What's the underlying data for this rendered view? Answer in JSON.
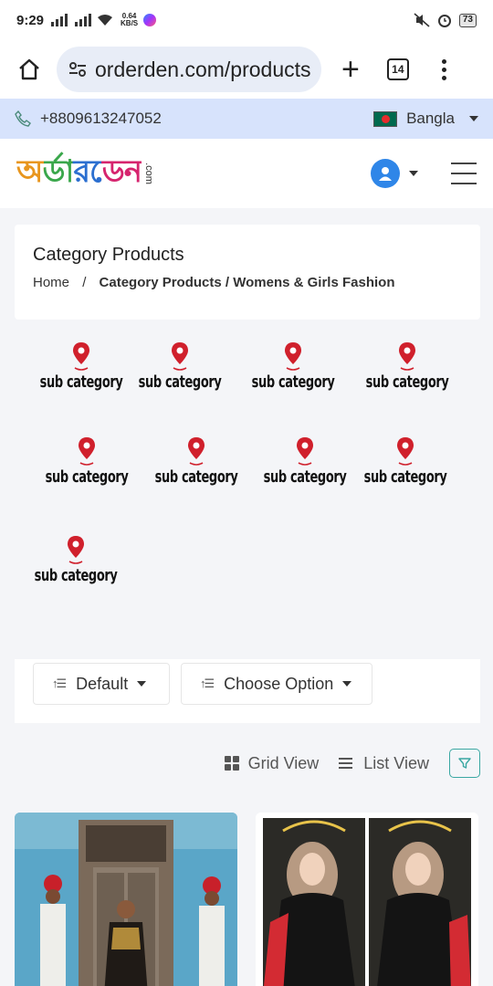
{
  "status_bar": {
    "time": "9:29",
    "net_speed_value": "0.64",
    "net_speed_unit": "KB/S",
    "battery": "73"
  },
  "browser": {
    "url": "orderden.com/products",
    "tab_count": "14"
  },
  "topbar": {
    "phone": "+8809613247052",
    "language": "Bangla"
  },
  "header": {
    "logo_text": "অর্ডারডেন",
    "logo_suffix": ".com"
  },
  "page": {
    "title": "Category Products",
    "breadcrumb": {
      "home": "Home",
      "separator": "/",
      "current": "Category Products / Womens & Girls Fashion"
    }
  },
  "sub_categories": [
    {
      "label": "sub category"
    },
    {
      "label": "sub category"
    },
    {
      "label": "sub category"
    },
    {
      "label": "sub category"
    },
    {
      "label": "sub category"
    },
    {
      "label": "sub category"
    },
    {
      "label": "sub category"
    },
    {
      "label": "sub category"
    },
    {
      "label": "sub category"
    }
  ],
  "sort": {
    "default_label": "Default",
    "option_label": "Choose Option"
  },
  "view": {
    "grid_label": "Grid View",
    "list_label": "List View"
  },
  "colors": {
    "accent": "#3aa7a2",
    "pin_red": "#d0202c",
    "topbar_bg": "#d7e3fc"
  }
}
